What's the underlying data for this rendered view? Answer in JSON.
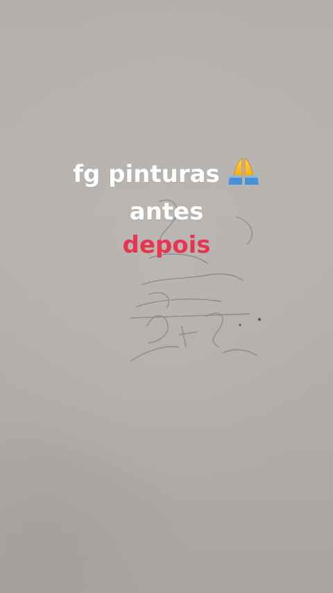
{
  "caption": {
    "line1": "fg pinturas",
    "line2": "antes",
    "line3": "depois",
    "line3_color": "#e8354f",
    "emoji": "folded-hands-icon"
  },
  "background": {
    "description_color": "#b3afac"
  }
}
